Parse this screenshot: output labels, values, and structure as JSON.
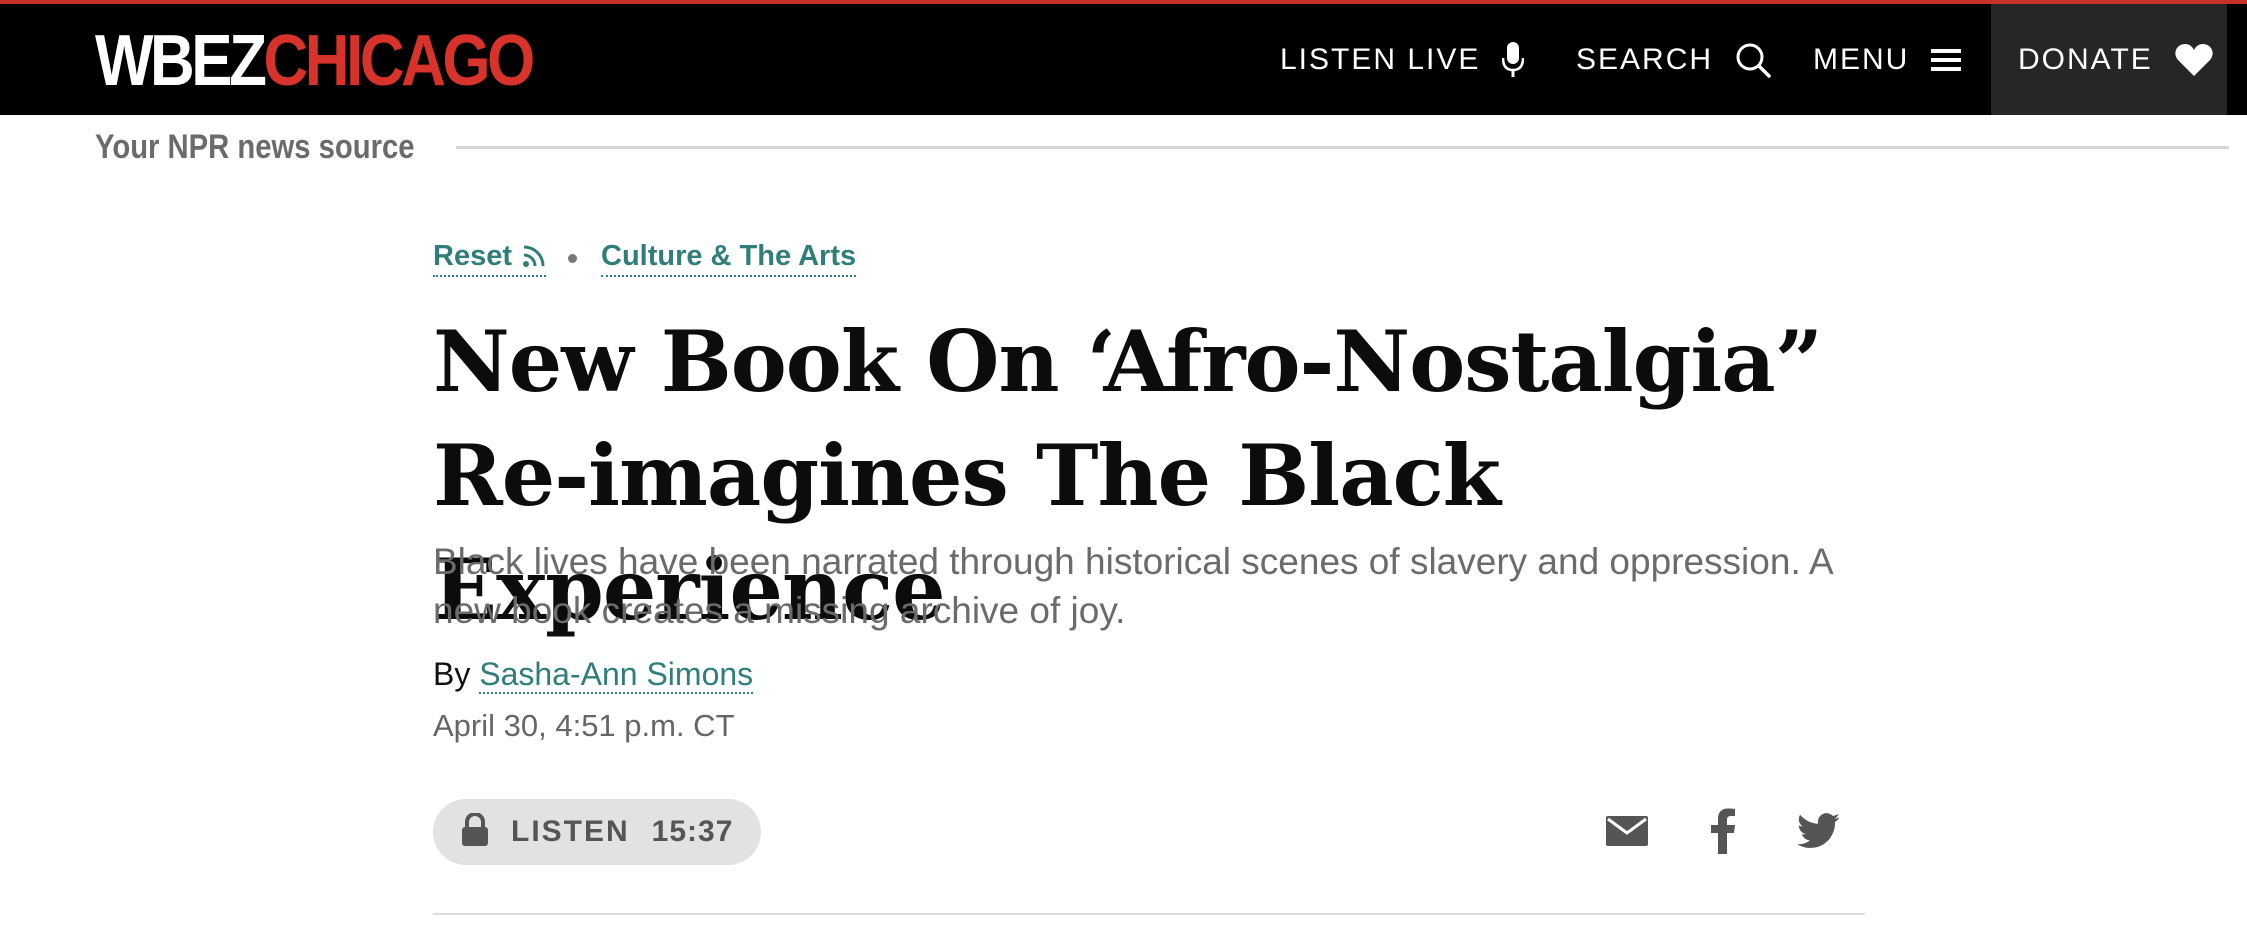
{
  "header": {
    "logo_part1": "WBEZ",
    "logo_part2": "CHICAGO",
    "nav": {
      "listen_live": "LISTEN LIVE",
      "search": "SEARCH",
      "menu": "MENU",
      "donate": "DONATE"
    },
    "tagline": "Your NPR news source"
  },
  "article": {
    "kicker": {
      "program": "Reset",
      "section": "Culture & The Arts"
    },
    "headline": "New Book On ‘Afro-Nostalgia” Re-imagines The Black Experience",
    "dek": "Black lives have been narrated through historical scenes of slavery and oppression. A new book creates a missing archive of joy.",
    "byline_prefix": "By",
    "author": "Sasha-Ann Simons",
    "date": "April 30, 4:51 p.m. CT",
    "listen": {
      "label": "LISTEN",
      "duration": "15:37"
    }
  },
  "icons": {
    "listen_live": "microphone-icon",
    "search": "search-icon",
    "menu": "hamburger-icon",
    "donate": "heart-icon",
    "rss": "rss-icon",
    "lock": "lock-icon",
    "mail": "mail-icon",
    "facebook": "facebook-icon",
    "twitter": "twitter-icon"
  },
  "colors": {
    "header_bg": "#000000",
    "brand_red": "#d8332a",
    "link_teal": "#2f7e7c",
    "donate_bg": "#262626",
    "pill_bg": "#e2e2e2"
  }
}
